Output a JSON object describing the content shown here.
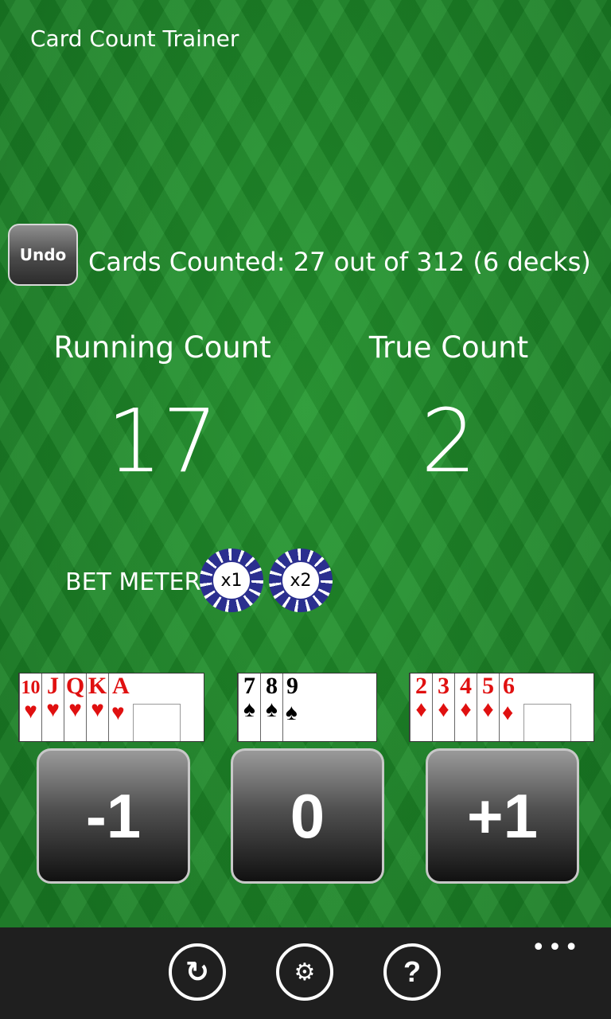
{
  "app": {
    "title": "Card Count Trainer"
  },
  "undo": {
    "label": "Undo"
  },
  "status": {
    "cards_counted": "Cards Counted: 27 out of 312 (6 decks)"
  },
  "counts": {
    "running_label": "Running Count",
    "running_value": "17",
    "true_label": "True Count",
    "true_value": "2"
  },
  "bet_meter": {
    "label": "BET METER",
    "chips": [
      "x1",
      "x2"
    ]
  },
  "card_groups": [
    {
      "cards": [
        "10",
        "J",
        "Q",
        "K"
      ],
      "last": "A",
      "suit": "♥",
      "color": "#e01010"
    },
    {
      "cards": [
        "7",
        "8"
      ],
      "last": "9",
      "suit": "♠",
      "color": "#000000"
    },
    {
      "cards": [
        "2",
        "3",
        "4",
        "5"
      ],
      "last": "6",
      "suit": "♦",
      "color": "#e01010"
    }
  ],
  "buttons": {
    "minus": "-1",
    "zero": "0",
    "plus": "+1"
  },
  "app_bar": {
    "refresh_icon": "↻",
    "settings_icon": "⚙",
    "help_icon": "?",
    "more": "•••"
  },
  "colors": {
    "felt": "#1f8a2a",
    "app_bar": "#1f1f1f",
    "chip": "#2b2f8f"
  }
}
